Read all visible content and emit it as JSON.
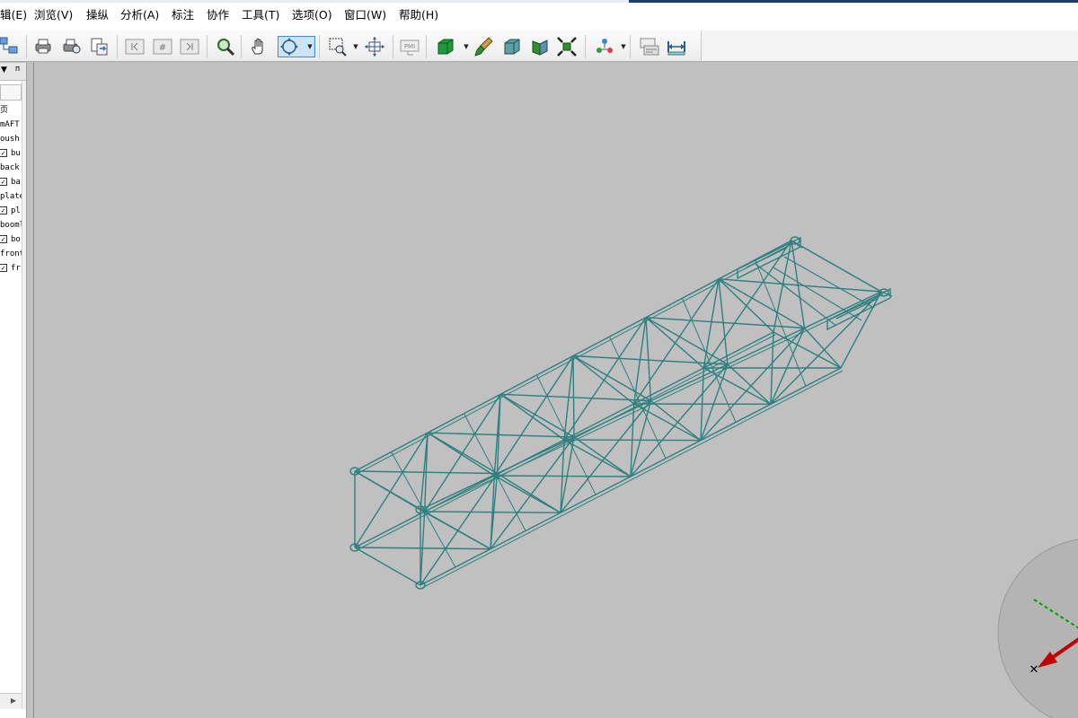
{
  "menu": {
    "items": [
      "辑(E)",
      "浏览(V)",
      "操纵",
      "分析(A)",
      "标注",
      "协作",
      "工具(T)",
      "选项(O)",
      "窗口(W)",
      "帮助(H)"
    ]
  },
  "toolbar": {
    "buttons": [
      {
        "name": "structure-tree-icon"
      },
      {
        "name": "print-icon"
      },
      {
        "name": "print-preview-icon"
      },
      {
        "name": "export-icon"
      },
      {
        "name": "previous-page-icon"
      },
      {
        "name": "page-number-icon"
      },
      {
        "name": "next-page-icon"
      },
      {
        "name": "zoom-find-icon"
      },
      {
        "name": "pan-hand-icon"
      },
      {
        "name": "rotate-icon"
      },
      {
        "name": "zoom-window-icon"
      },
      {
        "name": "fit-all-icon"
      },
      {
        "name": "pmi-icon"
      },
      {
        "name": "shaded-icon"
      },
      {
        "name": "paint-brush-icon"
      },
      {
        "name": "wireframe-box-icon"
      },
      {
        "name": "section-icon"
      },
      {
        "name": "explode-icon"
      },
      {
        "name": "assembly-icon"
      },
      {
        "name": "properties-icon"
      },
      {
        "name": "measure-icon"
      }
    ],
    "pmi_label": "PMI",
    "page_glyph": "#"
  },
  "left_panel": {
    "header_arrow": "▼",
    "pin_glyph": "ᴨ",
    "tree": [
      {
        "text": "页",
        "checked": null
      },
      {
        "text": "mAFT",
        "checked": null
      },
      {
        "text": "oush",
        "checked": null
      },
      {
        "text": "bu",
        "checked": true
      },
      {
        "text": "back",
        "checked": null
      },
      {
        "text": "ba",
        "checked": true
      },
      {
        "text": "plate",
        "checked": null
      },
      {
        "text": "pl",
        "checked": true
      },
      {
        "text": "booml",
        "checked": null
      },
      {
        "text": "bo",
        "checked": true
      },
      {
        "text": "front",
        "checked": null
      },
      {
        "text": "fr",
        "checked": true
      }
    ],
    "scroll_arrow": "▶"
  },
  "viewport": {
    "model_color": "#2e7f7f",
    "background_color": "#c0c0c0"
  },
  "triad": {
    "origin_label": "✕",
    "x_axis_color": "#c00000",
    "y_axis_color": "#00a000"
  }
}
